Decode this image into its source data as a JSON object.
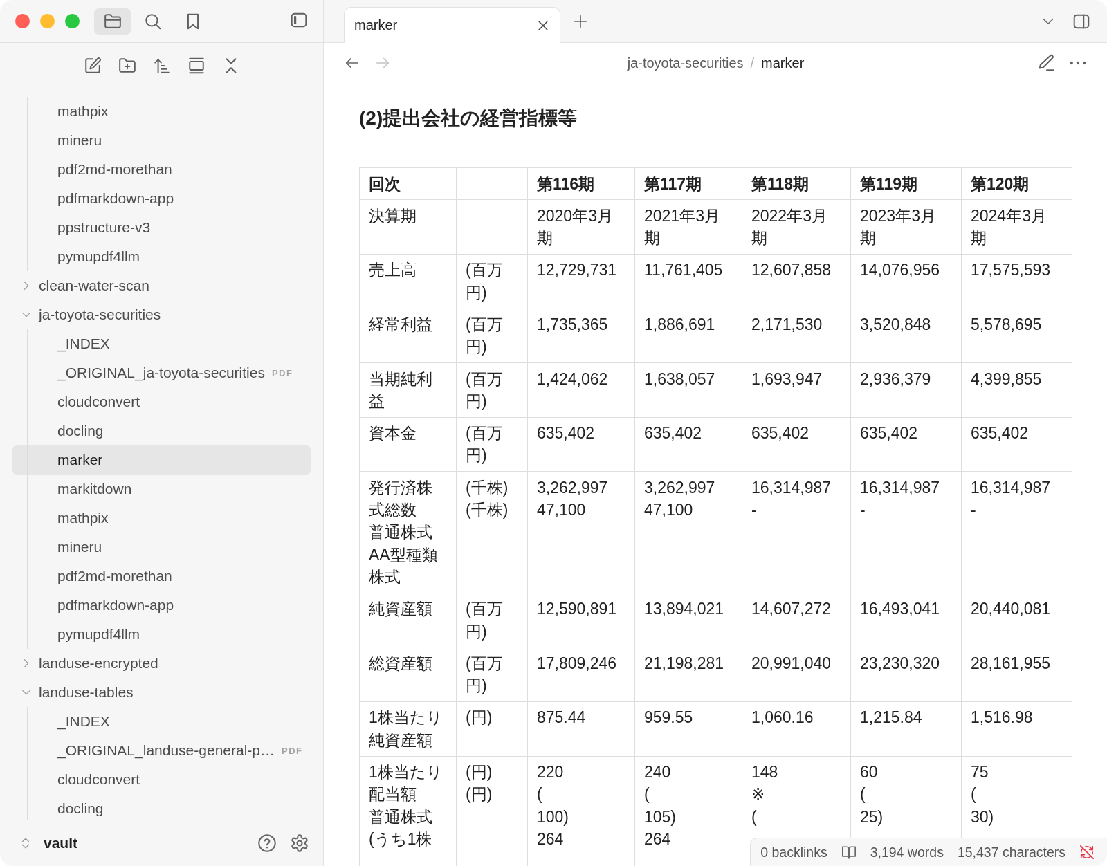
{
  "sidebar": {
    "header_icons": [
      {
        "kind": "files",
        "selected": true
      },
      {
        "kind": "search",
        "selected": false
      },
      {
        "kind": "bookmarks",
        "selected": false
      }
    ],
    "toolbar": [
      {
        "kind": "new-note"
      },
      {
        "kind": "new-folder"
      },
      {
        "kind": "sort"
      },
      {
        "kind": "auto-reveal"
      },
      {
        "kind": "collapse-all"
      }
    ],
    "tree": [
      {
        "kind": "folder",
        "expanded": true,
        "children": [
          {
            "kind": "file",
            "label": "mathpix",
            "selected": false
          },
          {
            "kind": "file",
            "label": "mineru",
            "selected": false
          },
          {
            "kind": "file",
            "label": "pdf2md-morethan",
            "selected": false
          },
          {
            "kind": "file",
            "label": "pdfmarkdown-app",
            "selected": false
          },
          {
            "kind": "file",
            "label": "ppstructure-v3",
            "selected": false
          },
          {
            "kind": "file",
            "label": "pymupdf4llm",
            "selected": false
          }
        ]
      },
      {
        "kind": "folder",
        "label": "clean-water-scan",
        "expanded": false,
        "selected": false
      },
      {
        "kind": "folder",
        "label": "ja-toyota-securities",
        "expanded": true,
        "selected": false,
        "children": [
          {
            "kind": "file",
            "label": "_INDEX",
            "selected": false
          },
          {
            "kind": "file",
            "label": "_ORIGINAL_ja-toyota-securities",
            "badge": "PDF",
            "selected": false
          },
          {
            "kind": "file",
            "label": "cloudconvert",
            "selected": false
          },
          {
            "kind": "file",
            "label": "docling",
            "selected": false
          },
          {
            "kind": "file",
            "label": "marker",
            "selected": true
          },
          {
            "kind": "file",
            "label": "markitdown",
            "selected": false
          },
          {
            "kind": "file",
            "label": "mathpix",
            "selected": false
          },
          {
            "kind": "file",
            "label": "mineru",
            "selected": false
          },
          {
            "kind": "file",
            "label": "pdf2md-morethan",
            "selected": false
          },
          {
            "kind": "file",
            "label": "pdfmarkdown-app",
            "selected": false
          },
          {
            "kind": "file",
            "label": "pymupdf4llm",
            "selected": false
          }
        ]
      },
      {
        "kind": "folder",
        "label": "landuse-encrypted",
        "expanded": false,
        "selected": false
      },
      {
        "kind": "folder",
        "label": "landuse-tables",
        "expanded": true,
        "selected": false,
        "children": [
          {
            "kind": "file",
            "label": "_INDEX",
            "selected": false
          },
          {
            "kind": "file",
            "label": "_ORIGINAL_landuse-general-p…",
            "badge": "PDF",
            "selected": false
          },
          {
            "kind": "file",
            "label": "cloudconvert",
            "selected": false
          },
          {
            "kind": "file",
            "label": "docling",
            "selected": false
          }
        ]
      }
    ],
    "vault": "vault"
  },
  "tabs": [
    {
      "label": "marker",
      "selected": true
    }
  ],
  "nav": {
    "back": {
      "disabled": false
    },
    "forward": {
      "disabled": true
    }
  },
  "breadcrumb": {
    "parent": "ja-toyota-securities",
    "separator": "/",
    "current": "marker"
  },
  "document": {
    "heading": "(2)提出会社の経営指標等",
    "table": {
      "columns": [
        "回次",
        null,
        "第116期",
        "第117期",
        "第118期",
        "第119期",
        "第120期"
      ],
      "rows": [
        [
          "決算期",
          null,
          "2020年3月期",
          "2021年3月期",
          "2022年3月期",
          "2023年3月期",
          "2024年3月期"
        ],
        [
          "売上高",
          "(百万円)",
          "12,729,731",
          "11,761,405",
          "12,607,858",
          "14,076,956",
          "17,575,593"
        ],
        [
          "経常利益",
          "(百万円)",
          "1,735,365",
          "1,886,691",
          "2,171,530",
          "3,520,848",
          "5,578,695"
        ],
        [
          "当期純利益",
          "(百万円)",
          "1,424,062",
          "1,638,057",
          "1,693,947",
          "2,936,379",
          "4,399,855"
        ],
        [
          "資本金",
          "(百万円)",
          "635,402",
          "635,402",
          "635,402",
          "635,402",
          "635,402"
        ],
        [
          [
            "発行済株式総数",
            "普通株式",
            "AA型種類株式"
          ],
          [
            "(千株)",
            "(千株)"
          ],
          [
            "3,262,997",
            "47,100"
          ],
          [
            "3,262,997",
            "47,100"
          ],
          [
            "16,314,987",
            "-"
          ],
          [
            "16,314,987",
            "-"
          ],
          [
            "16,314,987",
            "-"
          ]
        ],
        [
          "純資産額",
          "(百万円)",
          "12,590,891",
          "13,894,021",
          "14,607,272",
          "16,493,041",
          "20,440,081"
        ],
        [
          "総資産額",
          "(百万円)",
          "17,809,246",
          "21,198,281",
          "20,991,040",
          "23,230,320",
          "28,161,955"
        ],
        [
          "1株当たり純資産額",
          "(円)",
          "875.44",
          "959.55",
          "1,060.16",
          "1,215.84",
          "1,516.98"
        ],
        [
          [
            "1株当たり配当額",
            "普通株式",
            "(うち1株"
          ],
          [
            "(円)",
            "(円)"
          ],
          [
            "220",
            "(",
            "100)",
            "264"
          ],
          [
            "240",
            "(",
            "105)",
            "264"
          ],
          [
            "148",
            "※",
            "("
          ],
          [
            "60",
            "(",
            "25)"
          ],
          [
            "75",
            "(",
            "30)"
          ]
        ]
      ]
    }
  },
  "status_bar": {
    "backlinks": "0 backlinks",
    "words": "3,194 words",
    "characters": "15,437 characters"
  }
}
